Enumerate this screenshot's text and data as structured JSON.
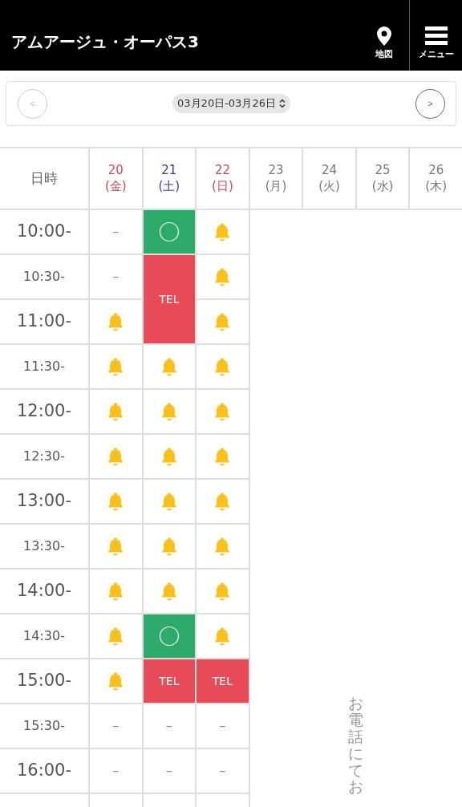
{
  "header": {
    "title": "アムアージュ・オーパス3",
    "map_label": "地図",
    "menu_label": "メニュー"
  },
  "week_nav": {
    "range": "03月20日-03月26日",
    "prev": "<",
    "next": ">",
    "prev_disabled": true
  },
  "table": {
    "corner": "日時",
    "times": [
      {
        "label": "10:00-",
        "major": true
      },
      {
        "label": "10:30-",
        "major": false
      },
      {
        "label": "11:00-",
        "major": true
      },
      {
        "label": "11:30-",
        "major": false
      },
      {
        "label": "12:00-",
        "major": true
      },
      {
        "label": "12:30-",
        "major": false
      },
      {
        "label": "13:00-",
        "major": true
      },
      {
        "label": "13:30-",
        "major": false
      },
      {
        "label": "14:00-",
        "major": true
      },
      {
        "label": "14:30-",
        "major": false
      },
      {
        "label": "15:00-",
        "major": true
      },
      {
        "label": "15:30-",
        "major": false
      },
      {
        "label": "16:00-",
        "major": true
      }
    ],
    "days": [
      {
        "day": "20",
        "weekday": "(金)",
        "color": "#d24a4a",
        "slots": [
          {
            "kind": "none",
            "text": "–"
          },
          {
            "kind": "none",
            "text": "–"
          },
          {
            "kind": "bell"
          },
          {
            "kind": "bell"
          },
          {
            "kind": "bell"
          },
          {
            "kind": "bell"
          },
          {
            "kind": "bell"
          },
          {
            "kind": "bell"
          },
          {
            "kind": "bell"
          },
          {
            "kind": "bell"
          },
          {
            "kind": "bell"
          },
          {
            "kind": "none",
            "text": "–"
          },
          {
            "kind": "none",
            "text": "–"
          },
          {
            "kind": "blank"
          }
        ]
      },
      {
        "day": "21",
        "weekday": "(土)",
        "color": "#3a3aaa",
        "slots": [
          {
            "kind": "open"
          },
          {
            "kind": "tel",
            "text": "TEL"
          },
          {
            "kind": "covered"
          },
          {
            "kind": "bell"
          },
          {
            "kind": "bell"
          },
          {
            "kind": "bell"
          },
          {
            "kind": "bell"
          },
          {
            "kind": "bell"
          },
          {
            "kind": "bell"
          },
          {
            "kind": "open"
          },
          {
            "kind": "tel",
            "text": "TEL"
          },
          {
            "kind": "none",
            "text": "–"
          },
          {
            "kind": "none",
            "text": "–"
          },
          {
            "kind": "blank"
          }
        ]
      },
      {
        "day": "22",
        "weekday": "(日)",
        "color": "#d24a4a",
        "slots": [
          {
            "kind": "bell"
          },
          {
            "kind": "bell"
          },
          {
            "kind": "bell"
          },
          {
            "kind": "bell"
          },
          {
            "kind": "bell"
          },
          {
            "kind": "bell"
          },
          {
            "kind": "bell"
          },
          {
            "kind": "bell"
          },
          {
            "kind": "bell"
          },
          {
            "kind": "bell"
          },
          {
            "kind": "tel",
            "text": "TEL"
          },
          {
            "kind": "none",
            "text": "–"
          },
          {
            "kind": "none",
            "text": "–"
          },
          {
            "kind": "blank"
          }
        ]
      },
      {
        "day": "23",
        "weekday": "(月)",
        "color": "#777777"
      },
      {
        "day": "24",
        "weekday": "(火)",
        "color": "#777777"
      },
      {
        "day": "25",
        "weekday": "(水)",
        "color": "#777777"
      },
      {
        "day": "26",
        "weekday": "(木)",
        "color": "#777777"
      }
    ],
    "note": "お電話にてお"
  }
}
